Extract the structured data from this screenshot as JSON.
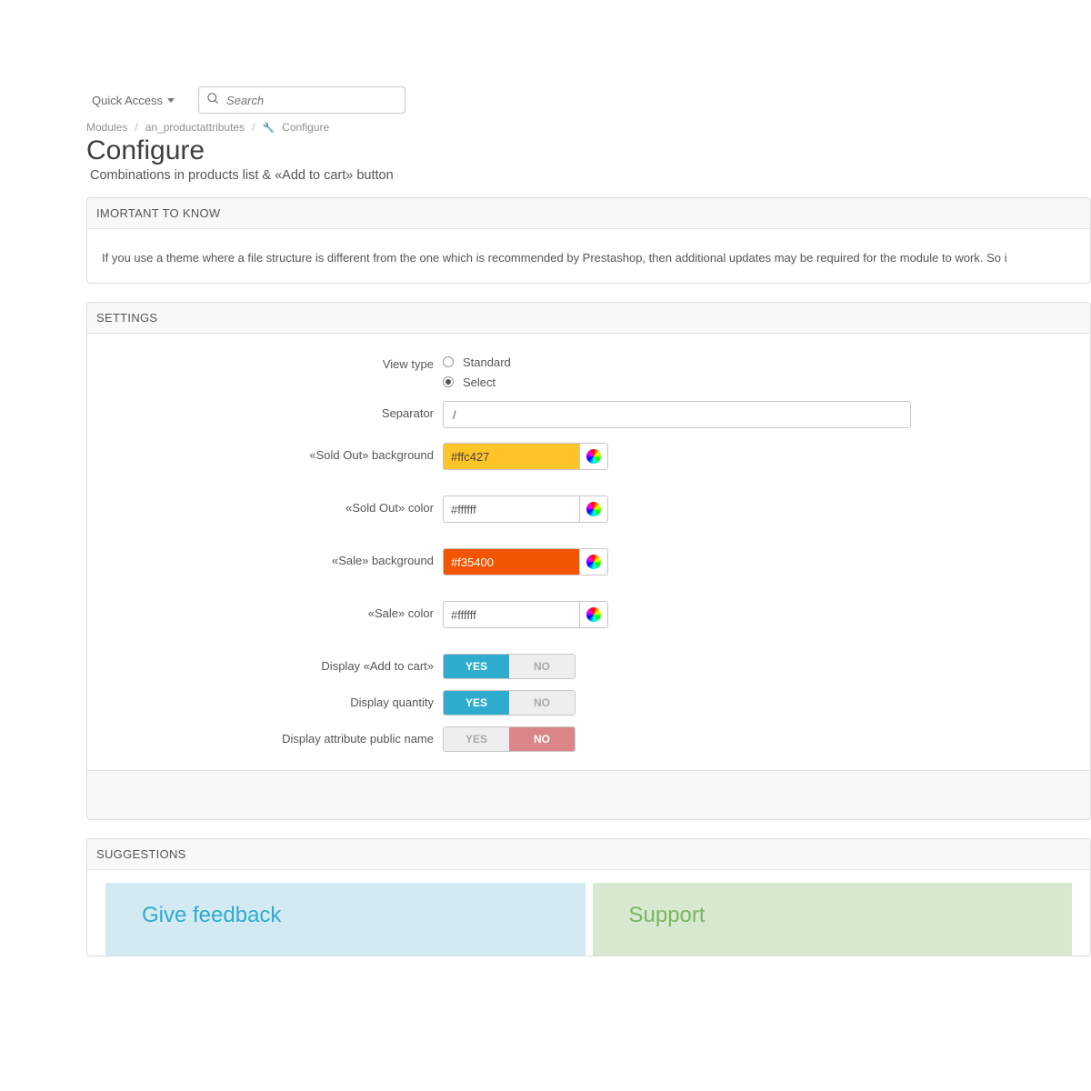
{
  "header": {
    "quick_access": "Quick Access",
    "search_placeholder": "Search"
  },
  "breadcrumb": {
    "item1": "Modules",
    "item2": "an_productattributes",
    "item3": "Configure"
  },
  "page": {
    "title": "Configure",
    "subtitle": "Combinations in products list & «Add to cart» button"
  },
  "important_panel": {
    "heading": "IMORTANT TO KNOW",
    "text": "If you use a theme where a file structure is different from the one which is recommended by Prestashop, then additional updates may be required for the module to work. So i"
  },
  "settings": {
    "heading": "SETTINGS",
    "view_type_label": "View type",
    "view_type_options": {
      "standard": "Standard",
      "select": "Select"
    },
    "view_type_selected": "select",
    "separator_label": "Separator",
    "separator_value": "/",
    "sold_out_background_label": "«Sold Out» background",
    "sold_out_background_value": "#ffc427",
    "sold_out_color_label": "«Sold Out» color",
    "sold_out_color_value": "#ffffff",
    "sale_background_label": "«Sale» background",
    "sale_background_value": "#f35400",
    "sale_color_label": "«Sale» color",
    "sale_color_value": "#ffffff",
    "display_add_to_cart_label": "Display «Add to cart»",
    "display_add_to_cart_value": "YES",
    "display_quantity_label": "Display quantity",
    "display_quantity_value": "YES",
    "display_attribute_name_label": "Display attribute public name",
    "display_attribute_name_value": "NO",
    "yes": "YES",
    "no": "NO"
  },
  "suggestions": {
    "heading": "SUGGESTIONS",
    "feedback_title": "Give feedback",
    "support_title": "Support"
  }
}
